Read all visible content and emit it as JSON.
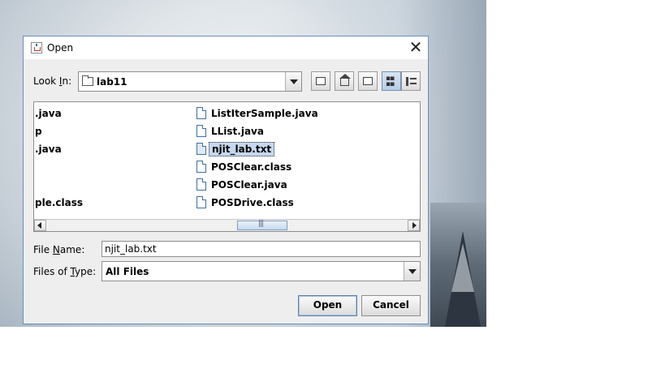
{
  "window": {
    "title": "Open",
    "close_glyph": "✕"
  },
  "toolbar": {
    "look_in_label_pre": "Look ",
    "look_in_label_mnemonic": "I",
    "look_in_label_post": "n:",
    "look_in_value": "lab11",
    "buttons": [
      "up-one-level-icon",
      "home-icon",
      "new-folder-icon",
      "list-view-icon",
      "details-view-icon"
    ],
    "active_view": "list-view"
  },
  "files": {
    "left_column": [
      ".java",
      "p",
      ".java",
      "",
      "",
      "ple.class"
    ],
    "right_column": [
      "ListIterSample.java",
      "LList.java",
      "njit_lab.txt",
      "POSClear.class",
      "POSClear.java",
      "POSDrive.class"
    ],
    "selected": "njit_lab.txt"
  },
  "form": {
    "file_name_pre": "File ",
    "file_name_mnemonic": "N",
    "file_name_post": "ame:",
    "file_name_value": "njit_lab.txt",
    "file_type_pre": "Files of ",
    "file_type_mnemonic": "T",
    "file_type_post": "ype:",
    "file_type_value": "All Files"
  },
  "buttons": {
    "open": "Open",
    "cancel": "Cancel"
  },
  "colors": {
    "selection": "#c6d8ee",
    "window_border": "#6d8fb8",
    "dialog_bg": "#eeeeee"
  }
}
